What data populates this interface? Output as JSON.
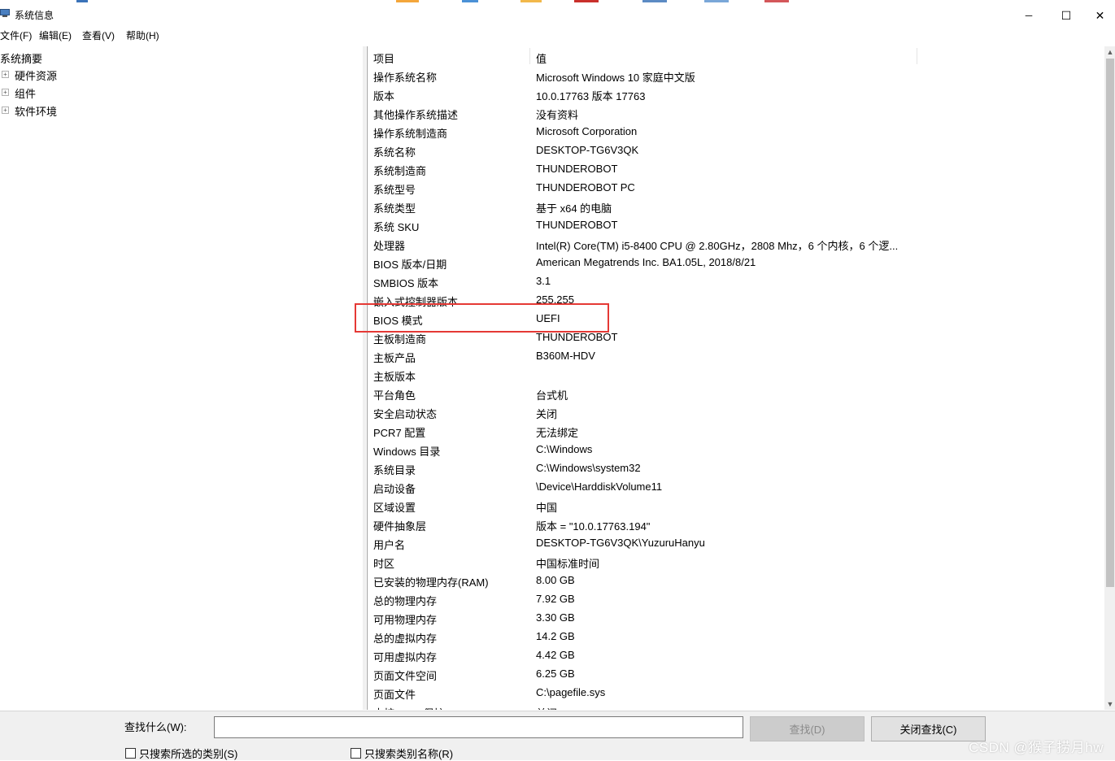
{
  "window": {
    "title": "系统信息",
    "controls": {
      "minimize": "─",
      "maximize": "☐",
      "close": "✕"
    }
  },
  "menu": [
    "文件(F)",
    "编辑(E)",
    "查看(V)",
    "帮助(H)"
  ],
  "tree": {
    "root": "系统摘要",
    "nodes": [
      {
        "label": "硬件资源",
        "icon": "expand-plus-icon"
      },
      {
        "label": "组件",
        "icon": "expand-plus-icon"
      },
      {
        "label": "软件环境",
        "icon": "expand-plus-icon"
      }
    ]
  },
  "table": {
    "headers": {
      "item": "项目",
      "value": "值"
    },
    "rows": [
      {
        "key": "操作系统名称",
        "value": "Microsoft Windows 10 家庭中文版"
      },
      {
        "key": "版本",
        "value": "10.0.17763 版本 17763"
      },
      {
        "key": "其他操作系统描述",
        "value": "没有资料"
      },
      {
        "key": "操作系统制造商",
        "value": "Microsoft Corporation"
      },
      {
        "key": "系统名称",
        "value": "DESKTOP-TG6V3QK"
      },
      {
        "key": "系统制造商",
        "value": "THUNDEROBOT"
      },
      {
        "key": "系统型号",
        "value": "THUNDEROBOT PC"
      },
      {
        "key": "系统类型",
        "value": "基于 x64 的电脑"
      },
      {
        "key": "系统 SKU",
        "value": "THUNDEROBOT"
      },
      {
        "key": "处理器",
        "value": "Intel(R) Core(TM) i5-8400 CPU @ 2.80GHz，2808 Mhz，6 个内核，6 个逻..."
      },
      {
        "key": "BIOS 版本/日期",
        "value": "American Megatrends Inc. BA1.05L, 2018/8/21"
      },
      {
        "key": "SMBIOS 版本",
        "value": "3.1"
      },
      {
        "key": "嵌入式控制器版本",
        "value": "255.255"
      },
      {
        "key": "BIOS 模式",
        "value": "UEFI"
      },
      {
        "key": "主板制造商",
        "value": "THUNDEROBOT"
      },
      {
        "key": "主板产品",
        "value": "B360M-HDV"
      },
      {
        "key": "主板版本",
        "value": ""
      },
      {
        "key": "平台角色",
        "value": "台式机"
      },
      {
        "key": "安全启动状态",
        "value": "关闭"
      },
      {
        "key": "PCR7 配置",
        "value": "无法绑定"
      },
      {
        "key": "Windows 目录",
        "value": "C:\\Windows"
      },
      {
        "key": "系统目录",
        "value": "C:\\Windows\\system32"
      },
      {
        "key": "启动设备",
        "value": "\\Device\\HarddiskVolume11"
      },
      {
        "key": "区域设置",
        "value": "中国"
      },
      {
        "key": "硬件抽象层",
        "value": "版本 = \"10.0.17763.194\""
      },
      {
        "key": "用户名",
        "value": "DESKTOP-TG6V3QK\\YuzuruHanyu"
      },
      {
        "key": "时区",
        "value": "中国标准时间"
      },
      {
        "key": "已安装的物理内存(RAM)",
        "value": "8.00 GB"
      },
      {
        "key": "总的物理内存",
        "value": "7.92 GB"
      },
      {
        "key": "可用物理内存",
        "value": "3.30 GB"
      },
      {
        "key": "总的虚拟内存",
        "value": "14.2 GB"
      },
      {
        "key": "可用虚拟内存",
        "value": "4.42 GB"
      },
      {
        "key": "页面文件空间",
        "value": "6.25 GB"
      },
      {
        "key": "页面文件",
        "value": "C:\\pagefile.sys"
      },
      {
        "key": "内核 DMA 保护",
        "value": "关闭"
      }
    ]
  },
  "find": {
    "label": "查找什么(W):",
    "value": "",
    "find_button": "查找(D)",
    "close_button": "关闭查找(C)",
    "option_selected_category": "只搜索所选的类别(S)",
    "option_category_names": "只搜索类别名称(R)"
  },
  "watermark": "CSDN @猴子捞月hw",
  "accent": {
    "highlight_border": "#e53935"
  }
}
